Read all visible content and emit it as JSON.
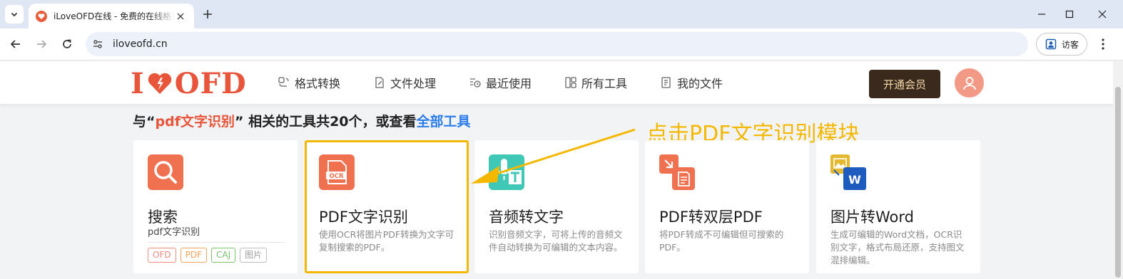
{
  "browser": {
    "tab_title": "iLoveOFD在线 - 免费的在线格式转换工具",
    "url": "iloveofd.cn",
    "profile_label": "访客"
  },
  "site": {
    "logo_left": "I",
    "logo_right": "OFD",
    "nav": [
      {
        "label": "格式转换",
        "icon": "convert-icon"
      },
      {
        "label": "文件处理",
        "icon": "file-edit-icon"
      },
      {
        "label": "最近使用",
        "icon": "recent-icon"
      },
      {
        "label": "所有工具",
        "icon": "tools-icon"
      },
      {
        "label": "我的文件",
        "icon": "my-files-icon"
      }
    ],
    "vip_button": "开通会员"
  },
  "results": {
    "prefix": "与“",
    "keyword": "pdf文字识别",
    "middle": "” 相关的工具共20个，或查看",
    "all_tools_link": "全部工具"
  },
  "annotation": "点击PDF文字识别模块",
  "cards": [
    {
      "title": "搜索",
      "icon": "search-icon",
      "search_value": "pdf文字识别",
      "tags": [
        {
          "label": "OFD",
          "color": "#f28b82"
        },
        {
          "label": "PDF",
          "color": "#f4a35a"
        },
        {
          "label": "CAJ",
          "color": "#7cc36b"
        },
        {
          "label": "图片",
          "color": "#9e9e9e"
        }
      ]
    },
    {
      "title": "PDF文字识别",
      "icon": "ocr-icon",
      "badge": "OCR",
      "description": "使用OCR将图片PDF转换为文字可复制搜索的PDF。"
    },
    {
      "title": "音频转文字",
      "icon": "audio-to-text-icon",
      "description": "识别音频文字，可将上传的音频文件自动转换为可编辑的文本内容。"
    },
    {
      "title": "PDF转双层PDF",
      "icon": "dual-layer-pdf-icon",
      "description": "将PDF转成不可编辑但可搜索的PDF。"
    },
    {
      "title": "图片转Word",
      "icon": "image-to-word-icon",
      "badge": "W",
      "description": "生成可编辑的Word文档，OCR识别文字，格式布局还原，支持图文混排编辑。"
    }
  ],
  "colors": {
    "brand": "#e8553a",
    "annotation": "#f5b800",
    "link": "#2b7de9",
    "vip_bg": "#3a2a1e"
  }
}
